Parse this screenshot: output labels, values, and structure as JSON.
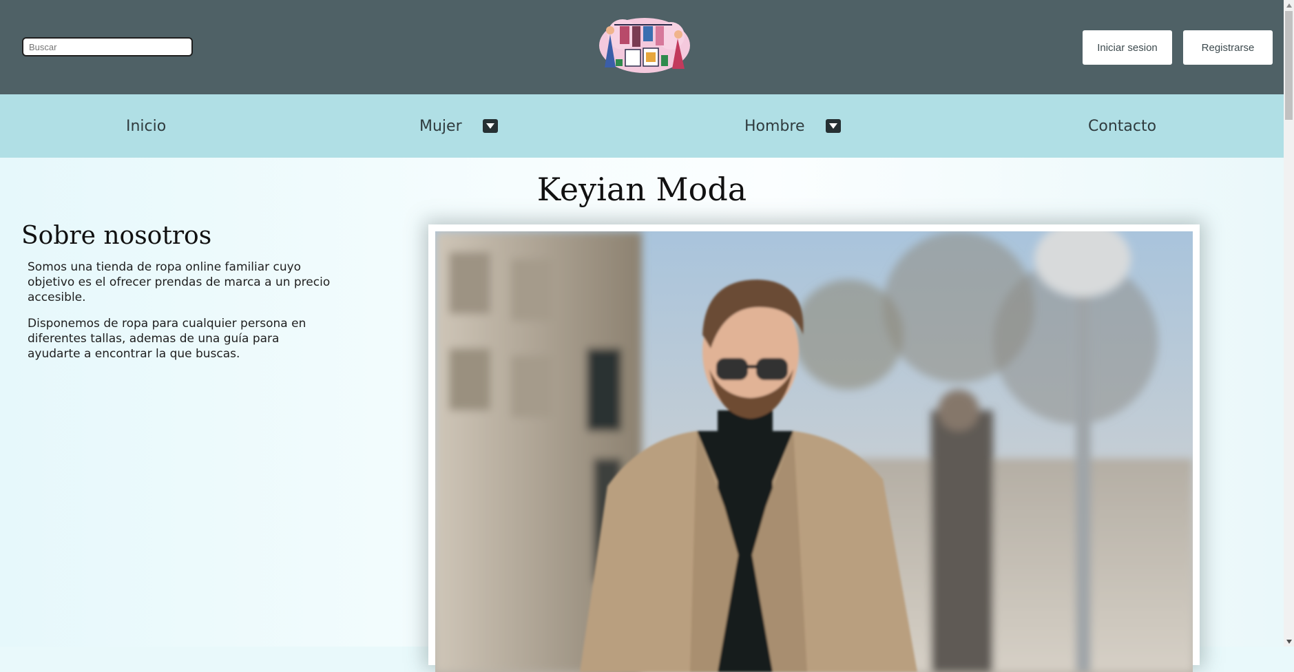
{
  "header": {
    "search": {
      "placeholder": "Buscar",
      "value": ""
    },
    "logo": "store-logo-illustration",
    "login_label": "Iniciar sesion",
    "register_label": "Registrarse"
  },
  "nav": {
    "items": [
      {
        "label": "Inicio"
      },
      {
        "label": "Mujer",
        "icon": "caret-down-icon"
      },
      {
        "label": "Hombre",
        "icon": "caret-down-icon"
      },
      {
        "label": "Contacto"
      }
    ]
  },
  "main": {
    "title": "Keyian Moda",
    "about": {
      "heading": "Sobre nosotros",
      "paragraphs": [
        "Somos una tienda de ropa online familiar cuyo objetivo es el ofrecer prendas de marca a un precio accesible.",
        "Disponemos de ropa para cualquier persona en diferentes tallas, ademas de una guía para ayudarte a encontrar la que buscas."
      ]
    },
    "hero_image": "man-in-coat-street-photo"
  },
  "colors": {
    "header_bg": "#4f6166",
    "nav_bg": "#b0dfe5",
    "page_bg": "#e9f9fb",
    "caret_bg": "#263033"
  }
}
